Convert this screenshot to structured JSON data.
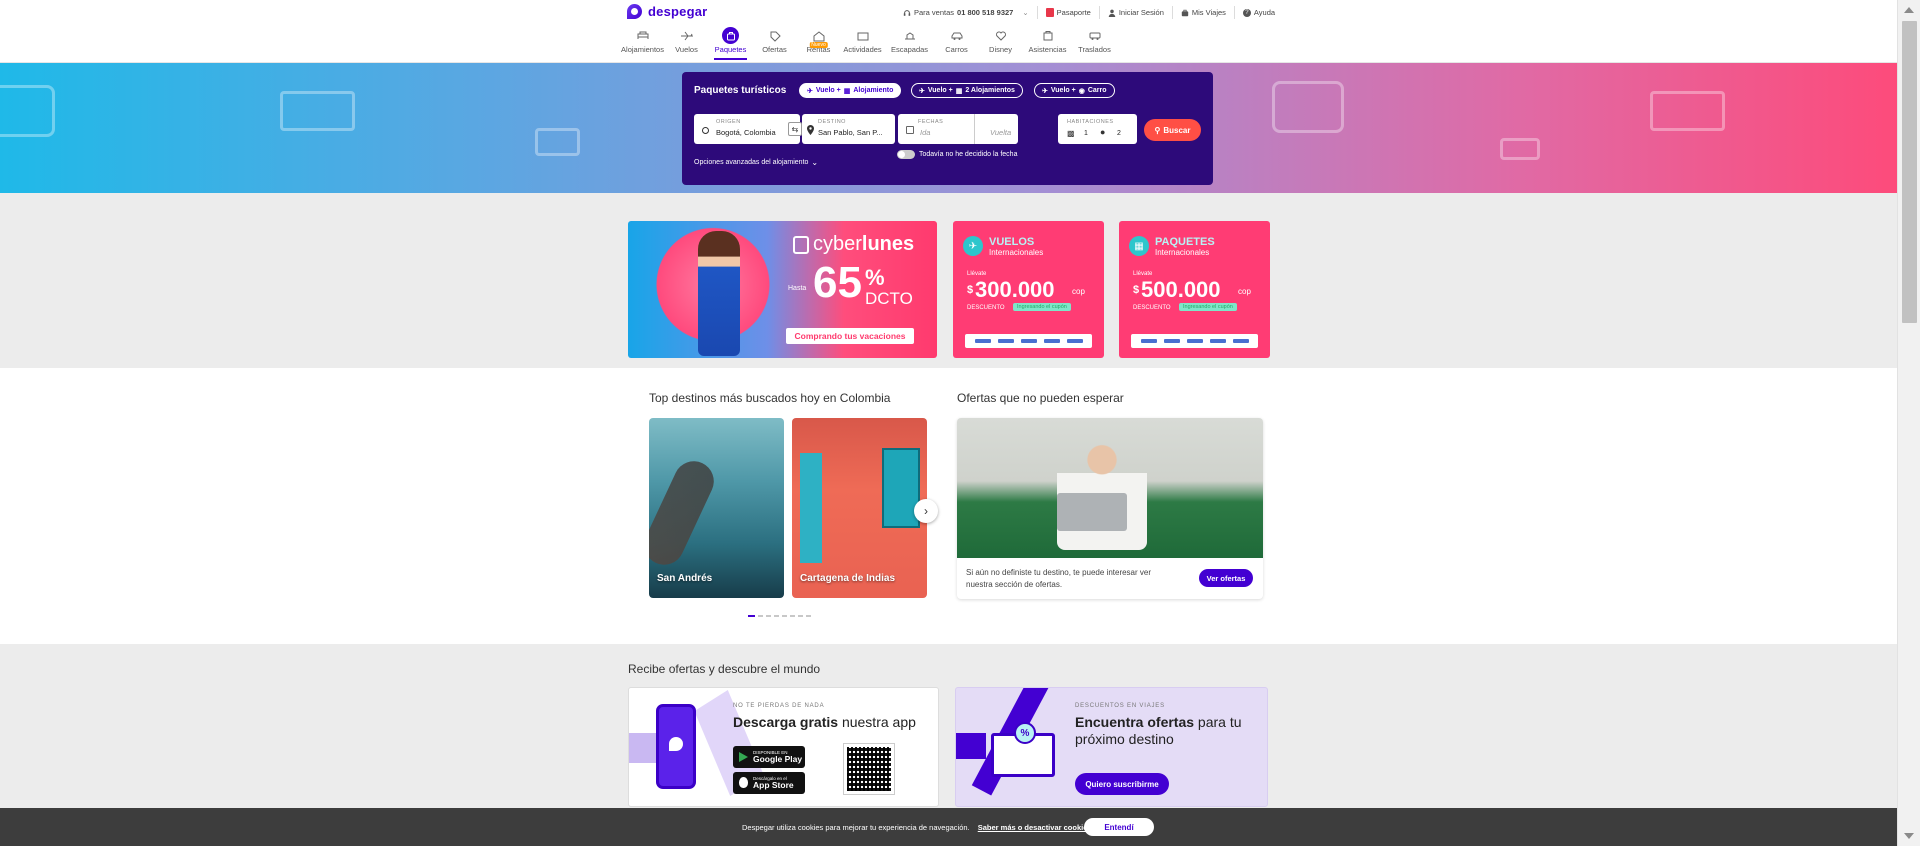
{
  "brand": {
    "name": "despegar",
    "color": "#4300d2"
  },
  "topbar": {
    "sales_label": "Para ventas",
    "sales_phone": "01 800 518 9327",
    "pasaporte": "Pasaporte",
    "login": "Iniciar Sesión",
    "trips": "Mis Viajes",
    "help": "Ayuda"
  },
  "nav": {
    "items": [
      {
        "label": "Alojamientos",
        "icon": "bed-icon"
      },
      {
        "label": "Vuelos",
        "icon": "plane-icon"
      },
      {
        "label": "Paquetes",
        "icon": "suitcase-icon",
        "active": true
      },
      {
        "label": "Ofertas",
        "icon": "tag-icon"
      },
      {
        "label": "Rentas",
        "icon": "house-icon",
        "badge": "Nuevo"
      },
      {
        "label": "Actividades",
        "icon": "ticket-icon"
      },
      {
        "label": "Escapadas",
        "icon": "escape-icon"
      },
      {
        "label": "Carros",
        "icon": "car-icon"
      },
      {
        "label": "Disney",
        "icon": "disney-icon"
      },
      {
        "label": "Asistencias",
        "icon": "assistance-icon"
      },
      {
        "label": "Traslados",
        "icon": "transfer-icon"
      }
    ]
  },
  "search": {
    "title": "Paquetes turísticos",
    "chips": [
      {
        "label": "Vuelo + ",
        "label2": "Alojamiento",
        "selected": true
      },
      {
        "label": "Vuelo + ",
        "label2": "2 Alojamientos",
        "selected": false
      },
      {
        "label": "Vuelo + ",
        "label2": "Carro",
        "selected": false
      }
    ],
    "origin": {
      "label": "ORIGEN",
      "value": "Bogotá, Colombia"
    },
    "destination": {
      "label": "DESTINO",
      "value": "San Pablo, San P..."
    },
    "dates": {
      "label": "FECHAS",
      "ida": "Ida",
      "vuelta": "Vuelta"
    },
    "rooms": {
      "label": "HABITACIONES",
      "rooms": "1",
      "people": "2"
    },
    "button": "Buscar",
    "advanced": "Opciones avanzadas del alojamiento",
    "no_date": "Todavía no he decidido la fecha"
  },
  "promos": {
    "cyber": {
      "brand_a": "cyber",
      "brand_b": "lunes",
      "hasta": "Hasta",
      "percent": "65",
      "percent_sign": "%",
      "dcto": "DCTO",
      "cta": "Comprando tus vacaciones"
    },
    "vuelos": {
      "title": "VUELOS",
      "subtitle": "Internacionales",
      "llevate": "Llévate",
      "currency_symbol": "$",
      "amount": "300.000",
      "currency": "cop",
      "descuento": "DESCUENTO",
      "tag": "Ingresando el cupón"
    },
    "paquetes": {
      "title": "PAQUETES",
      "subtitle": "Internacionales",
      "llevate": "Llévate",
      "currency_symbol": "$",
      "amount": "500.000",
      "currency": "cop",
      "descuento": "DESCUENTO",
      "tag": "Ingresando el cupón"
    }
  },
  "top_destinations": {
    "title": "Top destinos más buscados hoy en Colombia",
    "cards": [
      {
        "label": "San Andrés"
      },
      {
        "label": "Cartagena de Indias"
      }
    ]
  },
  "offers": {
    "title": "Ofertas que no pueden esperar",
    "text": "Si aún no definiste tu destino, te puede interesar ver nuestra sección de ofertas.",
    "button": "Ver ofertas"
  },
  "bottom": {
    "title": "Recibe ofertas y descubre el mundo",
    "app": {
      "kicker": "NO TE PIERDAS DE NADA",
      "headline_bold": "Descarga gratis",
      "headline_rest": " nuestra app",
      "google_small": "DISPONIBLE EN",
      "google_big": "Google Play",
      "apple_small": "Descárgalo en el",
      "apple_big": "App Store"
    },
    "subscribe": {
      "kicker": "DESCUENTOS EN VIAJES",
      "headline_bold": "Encuentra ofertas",
      "headline_rest": " para tu próximo destino",
      "button": "Quiero suscribirme"
    }
  },
  "cookie": {
    "text": "Despegar utiliza cookies para mejorar tu experiencia de navegación.",
    "link": "Saber más o desactivar cookies.",
    "button": "Entendí"
  }
}
